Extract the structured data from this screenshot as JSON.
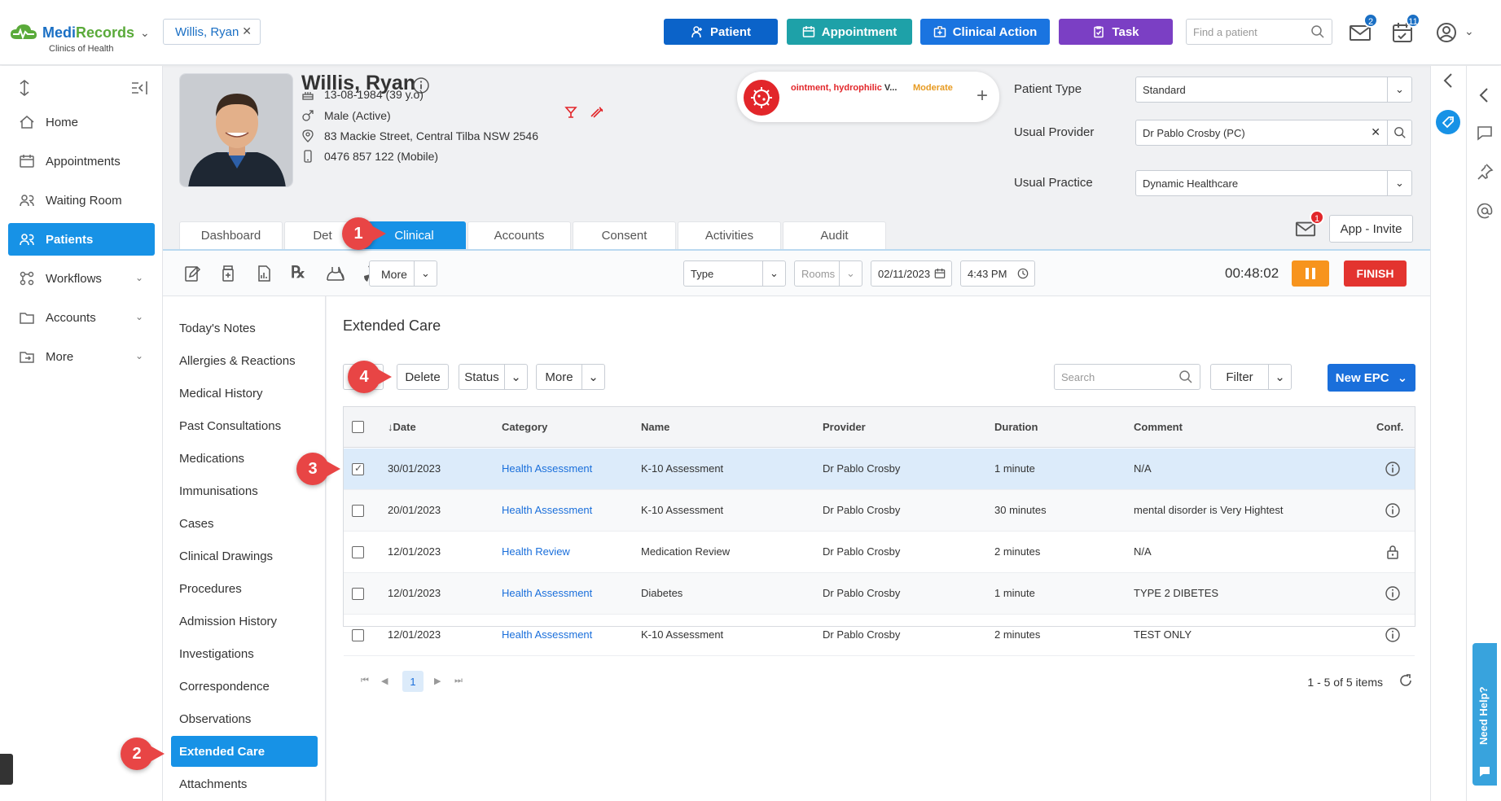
{
  "app": {
    "brand_a": "Medi",
    "brand_b": "Records",
    "subtitle": "Clinics of Health"
  },
  "header": {
    "patient_chip": "Willis, Ryan",
    "buttons": [
      {
        "label": "Patient",
        "color": "#0b63c9"
      },
      {
        "label": "Appointment",
        "color": "#1ea1a8"
      },
      {
        "label": "Clinical Action",
        "color": "#1a74e0"
      },
      {
        "label": "Task",
        "color": "#7b3fc4"
      }
    ],
    "find_placeholder": "Find a patient",
    "mail_badge": "2",
    "tasks_badge": "11"
  },
  "sidebar": {
    "items": [
      {
        "label": "Home",
        "icon": "home-icon"
      },
      {
        "label": "Appointments",
        "icon": "calendar-icon"
      },
      {
        "label": "Waiting Room",
        "icon": "users-icon"
      },
      {
        "label": "Patients",
        "icon": "patients-icon",
        "active": true
      },
      {
        "label": "Workflows",
        "icon": "workflow-icon",
        "expandable": true
      },
      {
        "label": "Accounts",
        "icon": "folder-icon",
        "expandable": true
      },
      {
        "label": "More",
        "icon": "folder-arrow-icon",
        "expandable": true
      }
    ]
  },
  "patient": {
    "name": "Willis, Ryan",
    "dob": "13-08-1984 (39 y.o)",
    "gender": "Male (Active)",
    "address": "83 Mackie Street, Central Tilba NSW 2546",
    "phone": "0476 857 122 (Mobile)",
    "allergy_text": "ointment, hydrophilic",
    "allergy_more": " V...",
    "allergy_severity": "Moderate",
    "patient_type_label": "Patient Type",
    "patient_type": "Standard",
    "usual_provider_label": "Usual Provider",
    "usual_provider": "Dr Pablo Crosby (PC)",
    "usual_practice_label": "Usual Practice",
    "usual_practice": "Dynamic Healthcare",
    "mail_badge": "1",
    "app_invite": "App - Invite"
  },
  "tabs": [
    "Dashboard",
    "Det",
    "Clinical",
    "Accounts",
    "Consent",
    "Activities",
    "Audit"
  ],
  "toolbar": {
    "more": "More",
    "type_placeholder": "Type",
    "rooms_placeholder": "Rooms",
    "date": "02/11/2023",
    "time": "4:43 PM",
    "timer": "00:48:02",
    "finish": "FINISH"
  },
  "subnav": [
    "Today's Notes",
    "Allergies & Reactions",
    "Medical History",
    "Past Consultations",
    "Medications",
    "Immunisations",
    "Cases",
    "Clinical Drawings",
    "Procedures",
    "Admission History",
    "Investigations",
    "Correspondence",
    "Observations",
    "Extended Care",
    "Attachments"
  ],
  "main": {
    "title": "Extended Care",
    "delete": "Delete",
    "status": "Status",
    "more": "More",
    "search_placeholder": "Search",
    "filter": "Filter",
    "new_epc": "New EPC",
    "columns": [
      "Date",
      "Category",
      "Name",
      "Provider",
      "Duration",
      "Comment",
      "Conf."
    ],
    "rows": [
      {
        "date": "30/01/2023",
        "category": "Health Assessment",
        "name": "K-10 Assessment",
        "provider": "Dr Pablo Crosby",
        "duration": "1 minute",
        "comment": "N/A",
        "conf": "info-icon",
        "checked": true
      },
      {
        "date": "20/01/2023",
        "category": "Health Assessment",
        "name": "K-10 Assessment",
        "provider": "Dr Pablo Crosby",
        "duration": "30 minutes",
        "comment": "mental disorder is Very Hightest",
        "conf": "info-icon",
        "checked": false
      },
      {
        "date": "12/01/2023",
        "category": "Health Review",
        "name": "Medication Review",
        "provider": "Dr Pablo Crosby",
        "duration": "2 minutes",
        "comment": "N/A",
        "conf": "lock-icon",
        "checked": false
      },
      {
        "date": "12/01/2023",
        "category": "Health Assessment",
        "name": "Diabetes",
        "provider": "Dr Pablo Crosby",
        "duration": "1 minute",
        "comment": "TYPE 2 DIBETES",
        "conf": "info-icon",
        "checked": false
      },
      {
        "date": "12/01/2023",
        "category": "Health Assessment",
        "name": "K-10 Assessment",
        "provider": "Dr Pablo Crosby",
        "duration": "2 minutes",
        "comment": "TEST ONLY",
        "conf": "info-icon",
        "checked": false
      }
    ],
    "page": "1",
    "pager_info": "1 - 5 of 5 items"
  },
  "need_help": "Need Help?",
  "callouts": [
    "1",
    "2",
    "3",
    "4"
  ]
}
